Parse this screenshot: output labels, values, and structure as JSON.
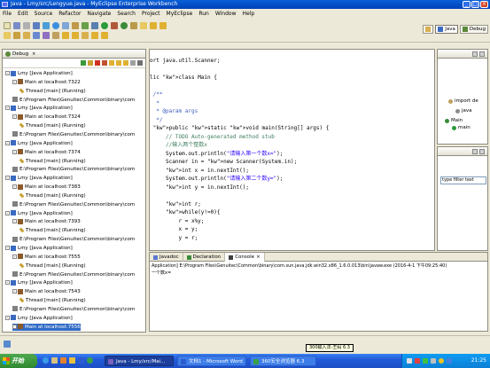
{
  "window": {
    "title": "Java - Lmy/src/Lengyue.java - MyEclipse Enterprise Workbench"
  },
  "menu": [
    "File",
    "Edit",
    "Source",
    "Refactor",
    "Navigate",
    "Search",
    "Project",
    "MyEclipse",
    "Run",
    "Window",
    "Help"
  ],
  "perspectives": [
    {
      "label": "Java",
      "active": true
    },
    {
      "label": "Debug",
      "active": false
    }
  ],
  "debug": {
    "tab_label": "Debug",
    "rows": [
      {
        "indent": 0,
        "icon": "launch-icon",
        "text": "Lmy [Java Application]",
        "exp": "-"
      },
      {
        "indent": 1,
        "icon": "vm-icon",
        "text": "Main at localhost:7322",
        "exp": "-"
      },
      {
        "indent": 2,
        "icon": "thread-icon",
        "text": "Thread [main] (Running)",
        "exp": ""
      },
      {
        "indent": 1,
        "icon": "process-icon",
        "text": "E:\\Program Files\\Genuitec\\Common\\binary\\com",
        "exp": ""
      },
      {
        "indent": 0,
        "icon": "launch-icon",
        "text": "Lmy [Java Application]",
        "exp": "-"
      },
      {
        "indent": 1,
        "icon": "vm-icon",
        "text": "Main at localhost:7324",
        "exp": "-"
      },
      {
        "indent": 2,
        "icon": "thread-icon",
        "text": "Thread [main] (Running)",
        "exp": ""
      },
      {
        "indent": 1,
        "icon": "process-icon",
        "text": "E:\\Program Files\\Genuitec\\Common\\binary\\com",
        "exp": ""
      },
      {
        "indent": 0,
        "icon": "launch-icon",
        "text": "Lmy [Java Application]",
        "exp": "-"
      },
      {
        "indent": 1,
        "icon": "vm-icon",
        "text": "Main at localhost:7374",
        "exp": "-"
      },
      {
        "indent": 2,
        "icon": "thread-icon",
        "text": "Thread [main] (Running)",
        "exp": ""
      },
      {
        "indent": 1,
        "icon": "process-icon",
        "text": "E:\\Program Files\\Genuitec\\Common\\binary\\com",
        "exp": ""
      },
      {
        "indent": 0,
        "icon": "launch-icon",
        "text": "Lmy [Java Application]",
        "exp": "-"
      },
      {
        "indent": 1,
        "icon": "vm-icon",
        "text": "Main at localhost:7383",
        "exp": "-"
      },
      {
        "indent": 2,
        "icon": "thread-icon",
        "text": "Thread [main] (Running)",
        "exp": ""
      },
      {
        "indent": 1,
        "icon": "process-icon",
        "text": "E:\\Program Files\\Genuitec\\Common\\binary\\com",
        "exp": ""
      },
      {
        "indent": 0,
        "icon": "launch-icon",
        "text": "Lmy [Java Application]",
        "exp": "-"
      },
      {
        "indent": 1,
        "icon": "vm-icon",
        "text": "Main at localhost:7393",
        "exp": "-"
      },
      {
        "indent": 2,
        "icon": "thread-icon",
        "text": "Thread [main] (Running)",
        "exp": ""
      },
      {
        "indent": 1,
        "icon": "process-icon",
        "text": "E:\\Program Files\\Genuitec\\Common\\binary\\com",
        "exp": ""
      },
      {
        "indent": 0,
        "icon": "launch-icon",
        "text": "Lmy [Java Application]",
        "exp": "-"
      },
      {
        "indent": 1,
        "icon": "vm-icon",
        "text": "Main at localhost:7555",
        "exp": "-"
      },
      {
        "indent": 2,
        "icon": "thread-icon",
        "text": "Thread [main] (Running)",
        "exp": ""
      },
      {
        "indent": 1,
        "icon": "process-icon",
        "text": "E:\\Program Files\\Genuitec\\Common\\binary\\com",
        "exp": ""
      },
      {
        "indent": 0,
        "icon": "launch-icon",
        "text": "Lmy [Java Application]",
        "exp": "-"
      },
      {
        "indent": 1,
        "icon": "vm-icon",
        "text": "Main at localhost:7543",
        "exp": "-"
      },
      {
        "indent": 2,
        "icon": "thread-icon",
        "text": "Thread [main] (Running)",
        "exp": ""
      },
      {
        "indent": 1,
        "icon": "process-icon",
        "text": "E:\\Program Files\\Genuitec\\Common\\binary\\com",
        "exp": ""
      },
      {
        "indent": 0,
        "icon": "launch-icon",
        "text": "Lmy [Java Application]",
        "exp": "-"
      },
      {
        "indent": 1,
        "icon": "vm-icon",
        "text": "Main at localhost:7556",
        "exp": "+",
        "selected": true
      }
    ]
  },
  "editor": {
    "lines": [
      {
        "t": "ort java.util.Scanner;",
        "c": "plain"
      },
      {
        "t": "",
        "c": "plain"
      },
      {
        "t": "lic class Main {",
        "c": "kw"
      },
      {
        "t": "",
        "c": "plain"
      },
      {
        "t": " /**",
        "c": "cj"
      },
      {
        "t": "  *",
        "c": "cj"
      },
      {
        "t": "  * @param args",
        "c": "cj"
      },
      {
        "t": "  */",
        "c": "cj"
      },
      {
        "t": " public static void main(String[] args) {",
        "c": "kw"
      },
      {
        "t": "     // TODO Auto-generated method stub",
        "c": "cm"
      },
      {
        "t": "     //输入两个整数x",
        "c": "cm"
      },
      {
        "t": "     System.out.println(\"请输入第一个数x=\");",
        "c": "st"
      },
      {
        "t": "     Scanner in = new Scanner(System.in);",
        "c": "kw"
      },
      {
        "t": "     int x = in.nextInt();",
        "c": "kw"
      },
      {
        "t": "     System.out.println(\"请输入第二个数y=\");",
        "c": "st"
      },
      {
        "t": "     int y = in.nextInt();",
        "c": "kw"
      },
      {
        "t": "",
        "c": "plain"
      },
      {
        "t": "     int r;",
        "c": "kw"
      },
      {
        "t": "     while(y!=0){",
        "c": "kw"
      },
      {
        "t": "         r = x%y;",
        "c": "plain"
      },
      {
        "t": "         x = y;",
        "c": "plain"
      },
      {
        "t": "         y = r;",
        "c": "plain"
      }
    ]
  },
  "outline": {
    "items": [
      "import de",
      "java",
      "Main",
      "main"
    ],
    "filter_placeholder": "type filter text"
  },
  "console": {
    "tabs": [
      "Javadoc",
      "Declaration",
      "Console"
    ],
    "active_tab": "Console",
    "header": "Application] E:\\Program Files\\Genuitec\\Common\\binary\\com.sun.java.jdk.win32.x86_1.6.0.013\\bin\\javaw.exe (2016-4-1 下午09:25:40)",
    "output": "一个数x="
  },
  "statusbar": {
    "tip": "300输入法-王码 6.3"
  },
  "taskbar": {
    "start_label": "开始",
    "tasks": [
      {
        "label": "Java - Lmy/src/Mai...",
        "active": true,
        "color": "#7b5fbf"
      },
      {
        "label": "文档1 - Microsoft Word",
        "active": false,
        "color": "#2b5ccf"
      },
      {
        "label": "360安全浏览器 6.3",
        "active": false,
        "color": "#38a047"
      }
    ],
    "clock": "21:25"
  }
}
